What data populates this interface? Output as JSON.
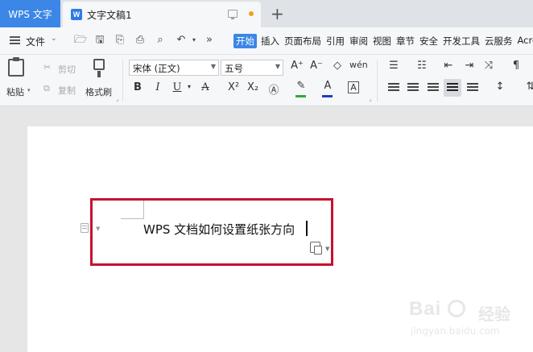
{
  "tabbar": {
    "app_tab": "WPS 文字",
    "doc_tab": {
      "icon_letter": "W",
      "title": "文字文稿1"
    }
  },
  "menubar": {
    "file_label": "文件",
    "ribbon_tabs": [
      "开始",
      "插入",
      "页面布局",
      "引用",
      "审阅",
      "视图",
      "章节",
      "安全",
      "开发工具",
      "云服务",
      "Acro"
    ],
    "active_tab": "开始"
  },
  "toolbar": {
    "paste_label": "粘贴",
    "cut_label": "剪切",
    "copy_label": "复制",
    "format_painter_label": "格式刷",
    "font_name": "宋体 (正文)",
    "font_size": "五号",
    "colors": {
      "highlight": "#2eaa3c",
      "font_color": "#1f3fbf"
    }
  },
  "document": {
    "text": "WPS 文档如何设置纸张方向"
  },
  "watermark": {
    "brand": "Bai",
    "brand_cn": "经验",
    "url": "jingyan.baidu.com"
  }
}
